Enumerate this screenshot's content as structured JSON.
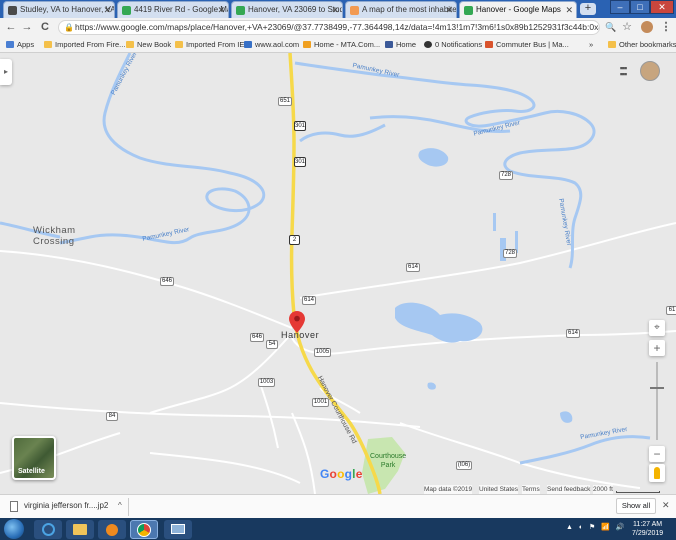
{
  "browser": {
    "tabs": [
      {
        "title": "Studley, VA to Hanover, VA –"
      },
      {
        "title": "4419 River Rd - Google Map"
      },
      {
        "title": "Hanover, VA 23069 to Studle"
      },
      {
        "title": "A map of the most inhabite"
      },
      {
        "title": "Hanover - Google Maps",
        "active": true
      }
    ],
    "new_tab": "+",
    "window_controls": {
      "minimize": "–",
      "maximize": "□",
      "close": "✕"
    },
    "back": "←",
    "forward": "→",
    "reload": "C",
    "url": "https://www.google.com/maps/place/Hanover,+VA+23069/@37.7738499,-77.364498,14z/data=!4m13!1m7!3m6!1s0x89b1252931f3c44b:0x4a91862660c61c9f!2sH...",
    "lock": "🔒",
    "omnibox_actions": [
      "🔍",
      "☆"
    ],
    "menu_icon": "⋮"
  },
  "bookmarks": {
    "items": [
      {
        "label": "Apps"
      },
      {
        "label": "Imported From Fire..."
      },
      {
        "label": "New Book"
      },
      {
        "label": "Imported From IE"
      },
      {
        "label": "www.aol.com"
      },
      {
        "label": "Home - MTA.Com..."
      },
      {
        "label": "Home"
      },
      {
        "label": "0 Notifications"
      },
      {
        "label": "Commuter Bus | Ma..."
      }
    ],
    "overflow": "»",
    "other": "Other bookmarks"
  },
  "map": {
    "places": {
      "wickham_1": "Wickham",
      "wickham_2": "Crossing",
      "hanover": "Hanover",
      "courthouse_1": "Courthouse",
      "courthouse_2": "Park"
    },
    "rivers": {
      "label": "Pamunkey River"
    },
    "road_label": "Hanover Courthouse Rd",
    "shields": {
      "r651": "651",
      "r301a": "301",
      "r301b": "301",
      "r2": "2",
      "r614a": "614",
      "r614b": "614",
      "r614c": "614",
      "r646a": "646",
      "r646b": "646",
      "r54": "54",
      "r1005": "1005",
      "r1003": "1003",
      "r1001": "1001",
      "r728a": "728",
      "r728b": "728",
      "r84": "84",
      "r646c": "646",
      "r1006": "(t06)",
      "r61": "61",
      "r646d": "646"
    },
    "google_logo": [
      "G",
      "o",
      "o",
      "g",
      "l",
      "e"
    ],
    "satellite_label": "Satellite",
    "controls": {
      "apps_icon": "⋮⋮⋮",
      "zoom_in": "+",
      "zoom_out": "−",
      "expand": "▸"
    },
    "attribution": {
      "map_data": "Map data ©2019",
      "country": "United States",
      "terms": "Terms",
      "feedback": "Send feedback",
      "scale": "2000 ft"
    },
    "colors": {
      "water": "#a6c8f2",
      "land": "#e8e8e8",
      "highway": "#f6d94a",
      "road": "#ffffff",
      "park": "#c8e6b0",
      "pin": "#e53935"
    }
  },
  "download": {
    "file_name": "virginia jefferson fr....jp2",
    "chevron": "^",
    "show_all": "Show all",
    "close": "✕"
  },
  "taskbar": {
    "time": "11:27 AM",
    "date": "7/29/2019",
    "tray": "▲ ◐ ⚑ 📶 🔊"
  }
}
